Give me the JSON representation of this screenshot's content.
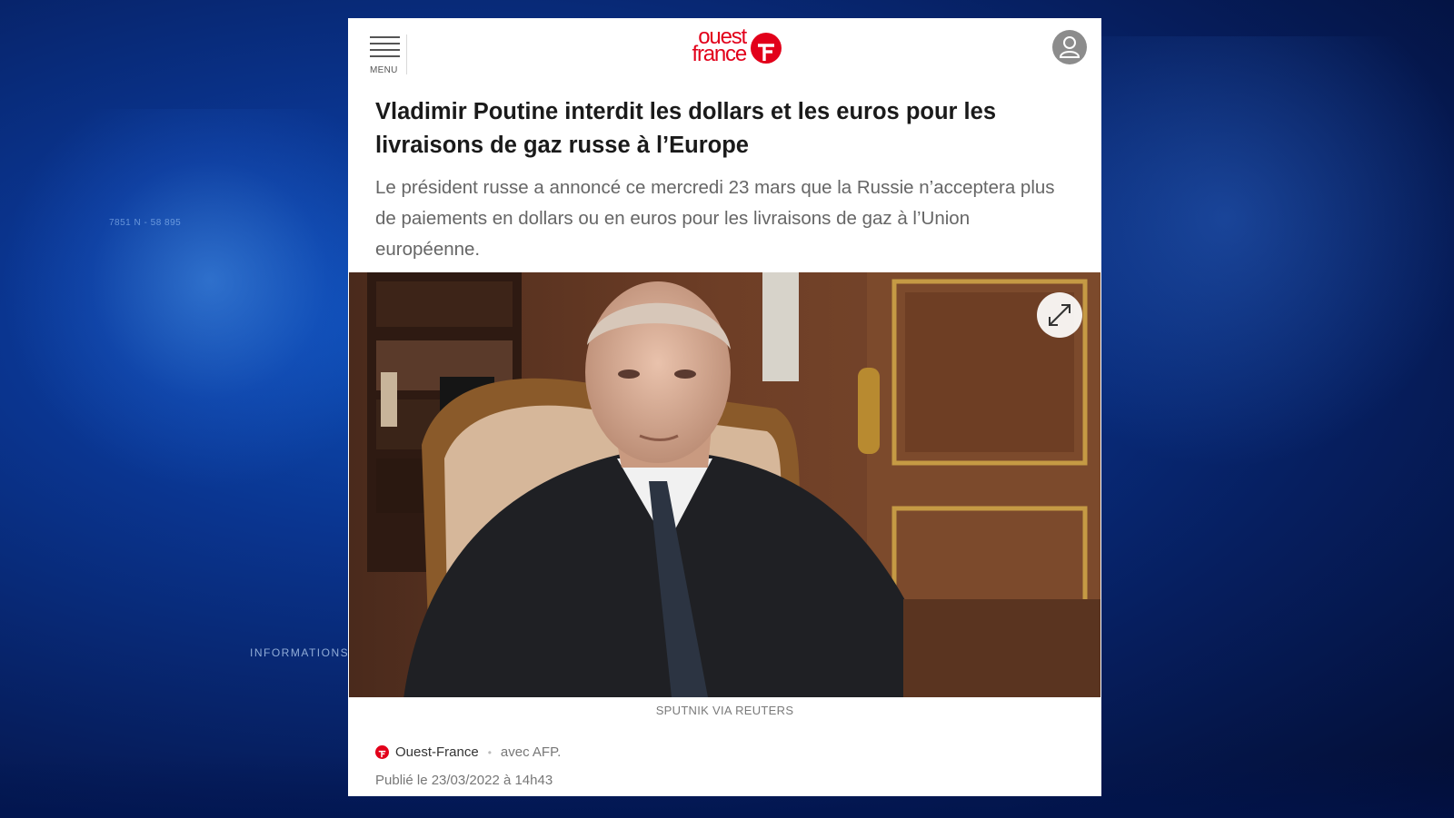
{
  "background": {
    "coord_text": "7851 N - 58 895",
    "info_text": "INFORMATIONS"
  },
  "header": {
    "menu_label": "MENU",
    "logo_line1": "ouest",
    "logo_line2": "france",
    "brand_color": "#e2001a"
  },
  "article": {
    "headline": "Vladimir Poutine interdit les dollars et les euros pour les livraisons de gaz russe à l’Europe",
    "chapo": "Le président russe a annoncé ce mercredi 23 mars que la Russie n’acceptera plus de paiements en dollars ou en euros pour les livraisons de gaz à l’Union européenne.",
    "photo_credit": "SPUTNIK VIA REUTERS",
    "source": "Ouest-France",
    "with": "avec AFP.",
    "published": "Publié le 23/03/2022 à 14h43"
  },
  "icons": {
    "menu": "hamburger-icon",
    "user": "user-icon",
    "expand": "expand-icon",
    "source_logo": "ouest-france-logo-icon"
  }
}
